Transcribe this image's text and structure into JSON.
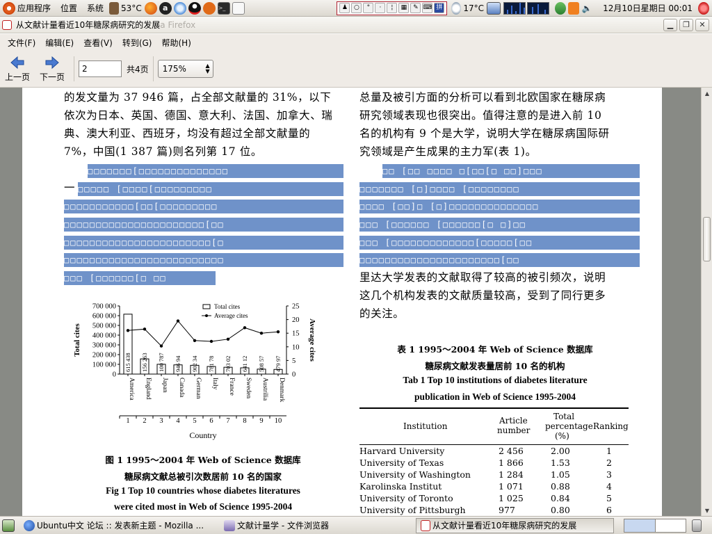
{
  "top_panel": {
    "apps_menu": "应用程序",
    "places_menu": "位置",
    "system_menu": "系统",
    "cpu_temp": "53°C",
    "weather_temp": "17°C",
    "clock": "12月10日星期日 00:01",
    "ime_label": "拼"
  },
  "window": {
    "title": "从文献计量看近10年糖尿病研究的发展",
    "title_ghost": "a Firefox"
  },
  "menu": [
    "文件(F)",
    "编辑(E)",
    "查看(V)",
    "转到(G)",
    "帮助(H)"
  ],
  "toolbar": {
    "prev_label": "上一页",
    "next_label": "下一页",
    "page_value": "2",
    "page_total": "共4页",
    "zoom_value": "175%"
  },
  "doc": {
    "left_para": [
      "的发文量为 37 946 篇，占全部文献量的 31%，以下",
      "依次为日本、英国、德国、意大利、法国、加拿大、瑞",
      "典、澳大利亚、西班牙，均没有超过全部文献量的",
      "7%，中国(1 387 篇)则名列第 17 位。"
    ],
    "left_dash": "一",
    "right_para": [
      "总量及被引方面的分析可以看到北欧国家在糖尿病",
      "研究领域表现也很突出。值得注意的是进入前 10",
      "名的机构有 9 个是大学，说明大学在糖尿病国际研",
      "究领域是产生成果的主力军(表 1)。"
    ],
    "right_para2": [
      "里达大学发表的文献取得了较高的被引频次，说明",
      "这几个机构发表的文献质量较高，受到了同行更多",
      "的关注。"
    ],
    "left_hl_rows": [
      "□□□□□□□[□□□□□□□□□□□□□□",
      "□□□□□ [□□□□[□□□□□□□□□",
      "□□□□□□□□□□□[□□[□□□□□□□□□",
      "□□□□□□□□□□□□□□□□□□□□□□[□□",
      "□□□□□□□□□□□□□□□□□□□□□□□[□",
      "□□□□□□□□□□□□□□□□□□□□□□□□□",
      "□□□ [□□□□□□[□  □□"
    ],
    "right_hl_rows": [
      "□□ [□□   □□□□  □[□□[□ □□]□□□",
      "□□□□□□□ [□]□□□□ [□□□□□□□□",
      "□□□□ [□□]□ [□]□□□□□□□□□□□□□□",
      "□□□ [□□□□□□ [□□□□□□[□  □]□□",
      "□□□ [□□□□□□□□□□□□□[□□□□□[□□",
      "□□□□□□□□□□□□□□□□□□□□□□[□□"
    ]
  },
  "chart_data": {
    "type": "bar",
    "categories": [
      "America",
      "England",
      "Japan",
      "Canada",
      "German",
      "Italy",
      "France",
      "Sweden",
      "Austrilia",
      "Denmark"
    ],
    "category_numbers": [
      "1",
      "2",
      "3",
      "4",
      "5",
      "6",
      "7",
      "8",
      "9",
      "10"
    ],
    "series": [
      {
        "name": "Total cites",
        "type": "bar",
        "axis": "left",
        "values": [
          615438,
          156263,
          100787,
          94694,
          90234,
          78178,
          70302,
          64112,
          50857,
          47997
        ],
        "value_labels": [
          "615 438",
          "156 263",
          "100 787",
          "946 94",
          "902 34",
          "781 78",
          "703 02",
          "641 12",
          "508 57",
          "479 97"
        ]
      },
      {
        "name": "Average cites",
        "type": "line",
        "axis": "right",
        "values": [
          16,
          16.5,
          10.3,
          19.5,
          12.3,
          12,
          12.8,
          17,
          15,
          15.5
        ]
      }
    ],
    "ylabel": "Total cites",
    "y2label": "Average cites",
    "xlabel": "Country",
    "ylim": [
      0,
      700000
    ],
    "y2lim": [
      0,
      25
    ],
    "yticks": [
      "700 000",
      "600 000",
      "500 000",
      "400 000",
      "300 000",
      "200 000",
      "100 000",
      "0"
    ],
    "y2ticks": [
      "25",
      "20",
      "15",
      "10",
      "5",
      "0"
    ],
    "legend_position": "top-right",
    "caption_cn_1": "图 1   1995～2004 年 Web of Science 数据库",
    "caption_cn_2": "糖尿病文献总被引次数居前 10 名的国家",
    "caption_en_1": "Fig 1    Top 10 countries whose diabetes literatures",
    "caption_en_2": "were cited most in Web of Science 1995-2004"
  },
  "table": {
    "title_cn_1": "表 1   1995～2004 年 Web of Science 数据库",
    "title_cn_2": "糖尿病文献发表量居前 10 名的机构",
    "title_en_1": "Tab 1    Top 10 institutions of diabetes literature",
    "title_en_2": "publication in Web of Science 1995-2004",
    "headers": [
      "Institution",
      "Article number",
      "Total percentage (%)",
      "Ranking"
    ],
    "header_article": [
      "Article",
      "number"
    ],
    "header_total": [
      "Total",
      "percentage",
      "(%)"
    ],
    "rows": [
      [
        "Harvard University",
        "2 456",
        "2.00",
        "1"
      ],
      [
        "University of Texas",
        "1 866",
        "1.53",
        "2"
      ],
      [
        "University of Washington",
        "1 284",
        "1.05",
        "3"
      ],
      [
        "Karolinska Institut",
        "1 071",
        "0.88",
        "4"
      ],
      [
        "University of Toronto",
        "1 025",
        "0.84",
        "5"
      ],
      [
        "University of Pittsburgh",
        "977",
        "0.80",
        "6"
      ]
    ]
  },
  "taskbar": [
    "Ubuntu中文 论坛 :: 发表新主题 - Mozilla ...",
    "文献计量学 - 文件浏览器",
    "从文献计量看近10年糖尿病研究的发展"
  ],
  "colors": {
    "highlight": "#6f92c9",
    "panel": "#dcd8d0"
  }
}
